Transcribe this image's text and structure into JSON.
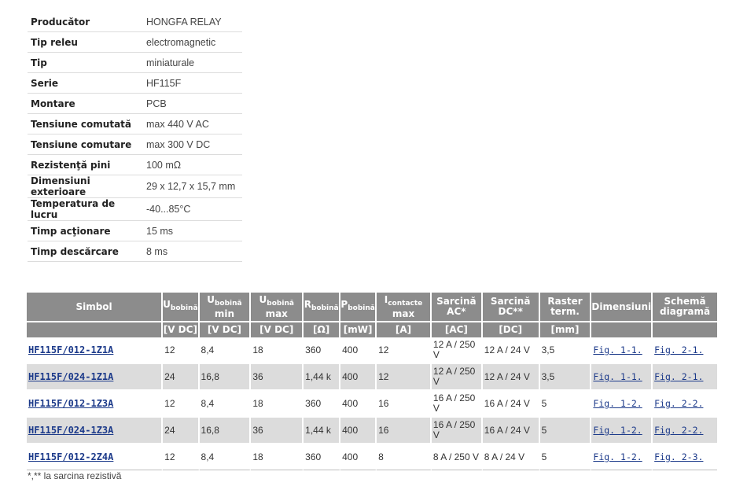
{
  "specs": [
    {
      "key": "Producător",
      "value": "HONGFA RELAY"
    },
    {
      "key": "Tip releu",
      "value": "electromagnetic"
    },
    {
      "key": "Tip",
      "value": "miniaturale"
    },
    {
      "key": "Serie",
      "value": "HF115F"
    },
    {
      "key": "Montare",
      "value": "PCB"
    },
    {
      "key": "Tensiune comutată",
      "value": "max 440 V AC"
    },
    {
      "key": "Tensiune comutare",
      "value": "max 300 V DC"
    },
    {
      "key": "Rezistenţă pini",
      "value": "100 mΩ"
    },
    {
      "key": "Dimensiuni exterioare",
      "value": "29 x 12,7 x 15,7 mm"
    },
    {
      "key": "Temperatura de lucru",
      "value": "-40...85°C"
    },
    {
      "key": "Timp acţionare",
      "value": "15 ms"
    },
    {
      "key": "Timp descărcare",
      "value": "8 ms"
    }
  ],
  "table": {
    "headers": {
      "simbol": "Simbol",
      "u_bob_main": "U",
      "u_bob_sub": "bobină",
      "u_min_main": "U",
      "u_min_sub": "bobină",
      "u_min_suffix": "min",
      "u_max_main": "U",
      "u_max_sub": "bobină",
      "u_max_suffix": "max",
      "r_main": "R",
      "r_sub": "bobină",
      "p_main": "P",
      "p_sub": "bobină",
      "i_main": "I",
      "i_sub": "contacte",
      "i_suffix": "max",
      "ac": "Sarcină AC*",
      "dc": "Sarcină DC**",
      "raster": "Raster term.",
      "dim": "Dimensiuni",
      "schema": "Schemă diagramă"
    },
    "units": [
      "",
      "[V DC]",
      "[V DC]",
      "[V DC]",
      "[Ω]",
      "[mW]",
      "[A]",
      "[AC]",
      "[DC]",
      "[mm]",
      "",
      ""
    ],
    "rows": [
      {
        "sym": "HF115F/012-1Z1A",
        "u": "12",
        "umin": "8,4",
        "umax": "18",
        "r": "360",
        "p": "400",
        "i": "12",
        "ac": "12 A / 250 V",
        "dc": "12 A / 24 V",
        "raster": "3,5",
        "dim": "Fig. 1-1.",
        "schema": "Fig. 2-1."
      },
      {
        "sym": "HF115F/024-1Z1A",
        "u": "24",
        "umin": "16,8",
        "umax": "36",
        "r": "1,44 k",
        "p": "400",
        "i": "12",
        "ac": "12 A / 250 V",
        "dc": "12 A / 24 V",
        "raster": "3,5",
        "dim": "Fig. 1-1.",
        "schema": "Fig. 2-1."
      },
      {
        "sym": "HF115F/012-1Z3A",
        "u": "12",
        "umin": "8,4",
        "umax": "18",
        "r": "360",
        "p": "400",
        "i": "16",
        "ac": "16 A / 250 V",
        "dc": "16 A / 24 V",
        "raster": "5",
        "dim": "Fig. 1-2.",
        "schema": "Fig. 2-2."
      },
      {
        "sym": "HF115F/024-1Z3A",
        "u": "24",
        "umin": "16,8",
        "umax": "36",
        "r": "1,44 k",
        "p": "400",
        "i": "16",
        "ac": "16 A / 250 V",
        "dc": "16 A / 24 V",
        "raster": "5",
        "dim": "Fig. 1-2.",
        "schema": "Fig. 2-2."
      },
      {
        "sym": "HF115F/012-2Z4A",
        "u": "12",
        "umin": "8,4",
        "umax": "18",
        "r": "360",
        "p": "400",
        "i": "8",
        "ac": "8 A / 250 V",
        "dc": "8 A / 24 V",
        "raster": "5",
        "dim": "Fig. 1-2.",
        "schema": "Fig. 2-3."
      }
    ]
  },
  "footnote": "*,** la sarcina rezistivă"
}
